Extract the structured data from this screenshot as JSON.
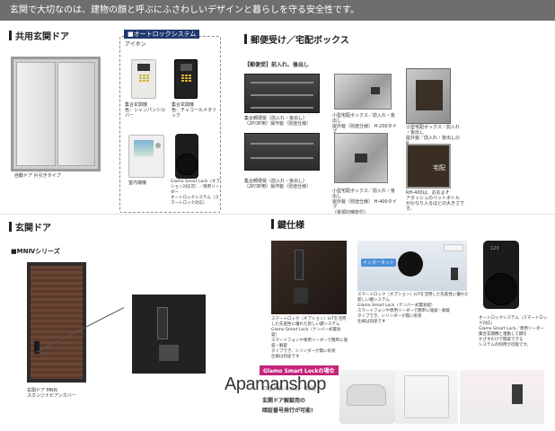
{
  "header": {
    "text": "玄関で大切なのは、建物の顔と呼ぶにふさわしいデザインと暮らしを守る安全性です。"
  },
  "sections": {
    "common_door": {
      "title": "共用玄関ドア",
      "caption": "自動ドア 片引きタイプ"
    },
    "autolock": {
      "tag": "■オートロックシステム",
      "brand": "アイホン",
      "panel_light_caption": "集合玄関機\n色：シャンパンシルバー",
      "panel_dark_caption": "集合玄関機\n色：チャコールメタリック",
      "monitor_caption": "室内端機",
      "smartlock_caption": "Glamo Smart Lock（オプション対応可）／専用リーダー\nオートロックシステム（スマートロック対応）"
    },
    "mailbox": {
      "title": "郵便受け／宅配ボックス",
      "subheading": "【郵便受】前入れ、後出し",
      "box1_caption": "集合郵便受（前入れ・後出し）\n（2P/3P用）操作錠（別途仕様）",
      "box2_caption": "集合郵便受（前入れ・後出し）\n（2P/3P用）操作錠（別途仕様）",
      "steel1_caption": "小型宅配ボックス／前入れ・後出し\n屋外錠（別途仕様） H-200タイプ\n（受領印機能付）",
      "steel2_caption": "小型宅配ボックス／前入れ・後出し\n屋外錠（別途仕様） H-400タイプ\n（受領印機能付）",
      "open1_caption": "小型宅配ボックス／前入れ\n・後出し\n屋外錠／前入れ・後出しのR\nレイメージ",
      "open2_caption": "RH-400は、おおよそ\nアタッシュのペットボトル\nがかなり入るほどの大きさです。",
      "open2_label": "宅配"
    },
    "entrance_door": {
      "title": "玄関ドア",
      "series": "■MNⅣシリーズ",
      "caption": "玄関ドア MNⅣ\nスカンジナビアンカバー"
    },
    "key": {
      "title": "鍵仕様",
      "photo_caption": "スマートロック（オプション）IoTを活用した先進性に優れた新しい鍵システム\nGlamo Smart Lock（ナンバー式電池錠）\nスマートフォンや専用リーダーで簡単に施錠・解錠\nタイプでき、シリンダーが無い形状\n仕様は別途です",
      "diagram_caption": "スマートロック（オプション）IoTを活用した先進性に優れた新しい鍵システム\nGlamo Smart Lock（ナンバー式電池錠）\nスマートフォンや専用リーダーで簡単に施錠・解錠\nタイプでき、シリンダーが無い形状\n仕様は別途です",
      "internet_label": "インターネット",
      "reader_caption": "オートロックシステム（スマートロック対応）\nGlamo Smart Lock／専用リーダー\n集合玄関機と連動して鍵を\nかざすだけで開錠できる\nシステムの利用が可能です。",
      "promo_tag": "Glamo Smart Lockの場合",
      "promo_line1": "月額有料の点錠・解錠",
      "promo_line2": "玄関ドア解錠用の",
      "promo_line3": "暗証番号発行が可能!",
      "reader_screen": "123"
    }
  },
  "watermark": "Apamanshop",
  "colors": {
    "header_bg": "#6e6e6e",
    "tag_navy": "#1f3a6e",
    "promo_magenta": "#c4247a"
  }
}
